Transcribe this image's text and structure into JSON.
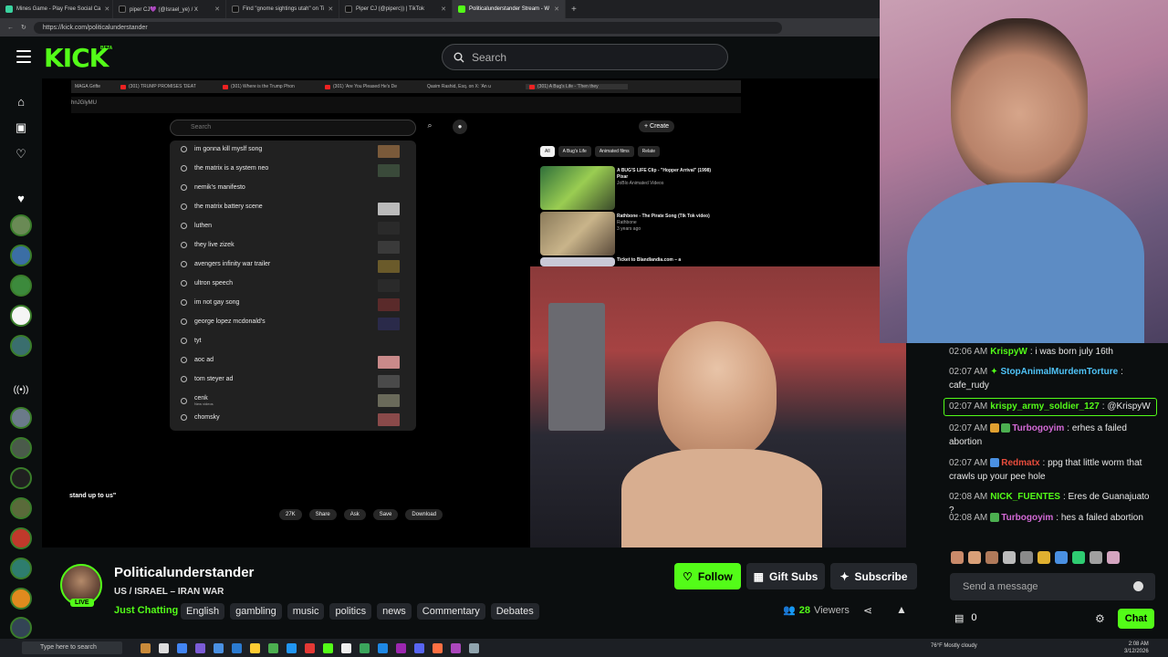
{
  "browser": {
    "tabs": [
      {
        "label": "Mines Game - Play Free Social Ca",
        "color": "#3ad29f"
      },
      {
        "label": "piper CJ💜 (@Israel_ye) / X",
        "color": "#111111"
      },
      {
        "label": "Find \"gnome sightings utah\" on Ti",
        "color": "#111111"
      },
      {
        "label": "Piper CJ (@piperc)) | TikTok",
        "color": "#111111"
      },
      {
        "label": "Politicalunderstander Stream - W",
        "color": "#53fc18"
      }
    ],
    "url": "https://kick.com/politicalunderstander"
  },
  "header": {
    "logo": "KICK",
    "beta": "BETA",
    "search_placeholder": "Search"
  },
  "stream_content": {
    "inner_tabs": [
      "MAGA Grifte",
      "(301) TRUMP PROMISES 'DEAT",
      "(301) Where is the Trump Phon",
      "(301) 'Are You Pleased He's De",
      "Qasim Rashid, Esq. on X: 'An u",
      "(301) A Bug's Life - 'Then they"
    ],
    "inner_url": "hnJGlyMU",
    "yt_search_placeholder": "Search",
    "yt_create": "+ Create",
    "suggestions": [
      {
        "text": "im gonna kill myslf song",
        "note": ""
      },
      {
        "text": "the matrix is a system neo",
        "note": ""
      },
      {
        "text": "nemik's manifesto",
        "note": ""
      },
      {
        "text": "the matrix battery scene",
        "note": ""
      },
      {
        "text": "luthen",
        "note": ""
      },
      {
        "text": "they live zizek",
        "note": ""
      },
      {
        "text": "avengers infinity war trailer",
        "note": ""
      },
      {
        "text": "ultron speech",
        "note": ""
      },
      {
        "text": "im not gay song",
        "note": ""
      },
      {
        "text": "george lopez mcdonald's",
        "note": ""
      },
      {
        "text": "tyt",
        "note": ""
      },
      {
        "text": "aoc ad",
        "note": ""
      },
      {
        "text": "tom steyer ad",
        "note": ""
      },
      {
        "text": "cenk",
        "note": "New videos"
      },
      {
        "text": "chomsky",
        "note": ""
      }
    ],
    "chips": [
      "All",
      "A Bug's Life",
      "Animated films",
      "Relate"
    ],
    "videos": [
      {
        "title": "A BUG'S LIFE Clip - \"Hopper Arrival\" (1998) Pixar",
        "channel": "JoBlo Animated Videos",
        "stats": ""
      },
      {
        "title": "Rathbone - The Pirate Song (Tik Tok video)",
        "channel": "Rathbone",
        "stats": "3 years ago"
      },
      {
        "title": "Ticket to Blandlandia.com – a",
        "channel": "",
        "stats": ""
      }
    ],
    "caption": "stand up to us\"",
    "actions": [
      "27K",
      "Share",
      "Ask",
      "Save",
      "Download"
    ]
  },
  "channel": {
    "name": "Politicalunderstander",
    "live": "LIVE",
    "title": "US / ISRAEL – IRAN WAR",
    "category": "Just Chatting",
    "tags": [
      "English",
      "gambling",
      "music",
      "politics",
      "news",
      "Commentary",
      "Debates"
    ],
    "follow_label": "Follow",
    "gift_label": "Gift Subs",
    "subscribe_label": "Subscribe",
    "viewers_count": "28",
    "viewers_label": "Viewers"
  },
  "chat": {
    "messages": [
      {
        "time": "02:06 AM",
        "user": "KrispyW",
        "color": "#53fc18",
        "text": "i was born july 16th"
      },
      {
        "time": "02:07 AM",
        "user": "StopAnimalMurdemTorture",
        "color": "#4fc3f7",
        "text": "cafe_rudy"
      },
      {
        "time": "02:07 AM",
        "user": "krispy_army_soldier_127",
        "color": "#53fc18",
        "text": "@KrispyW"
      },
      {
        "time": "02:07 AM",
        "user": "Turbogoyim",
        "color": "#d36ad6",
        "text": "erhes a failed abortion"
      },
      {
        "time": "02:07 AM",
        "user": "Redmatx",
        "color": "#e74c3c",
        "text": "ppg that little worm that crawls up your pee hole"
      },
      {
        "time": "02:08 AM",
        "user": "NICK_FUENTES",
        "color": "#53fc18",
        "text": "Eres de Guanajuato ?"
      },
      {
        "time": "02:08 AM",
        "user": "Turbogoyim",
        "color": "#d36ad6",
        "text": "hes a failed abortion"
      }
    ],
    "input_placeholder": "Send a message",
    "points": "0",
    "chat_button": "Chat"
  },
  "taskbar": {
    "search_placeholder": "Type here to search",
    "weather": "76°F  Mostly cloudy",
    "time": "2:08 AM",
    "date": "3/12/2026"
  },
  "colors": {
    "kick_green": "#53fc18",
    "background": "#0b0e0f",
    "panel": "#24272c"
  }
}
